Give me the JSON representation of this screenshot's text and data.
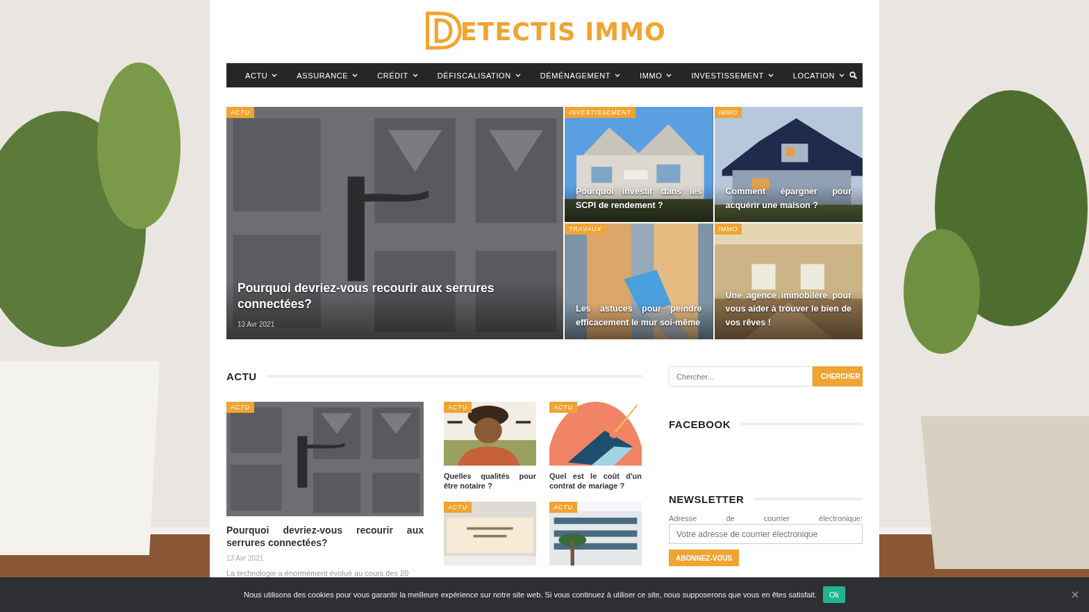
{
  "logo": {
    "initial": "D",
    "rest": "ETECTIS IMMO"
  },
  "nav": [
    {
      "label": "ACTU"
    },
    {
      "label": "ASSURANCE"
    },
    {
      "label": "CRÉDIT"
    },
    {
      "label": "DÉFISCALISATION"
    },
    {
      "label": "DÉMÉNAGEMENT"
    },
    {
      "label": "IMMO"
    },
    {
      "label": "INVESTISSEMENT"
    },
    {
      "label": "LOCATION"
    }
  ],
  "hero": [
    {
      "category": "ACTU",
      "title": "Pourquoi devriez-vous recourir aux serrures connectées?",
      "date": "13 Avr 2021"
    },
    {
      "category": "INVESTISSEMENT",
      "title": "Pourquoi investir dans les SCPI de rendement ?"
    },
    {
      "category": "IMMO",
      "title": "Comment épargner pour acquérir une maison ?"
    },
    {
      "category": "TRAVAUX",
      "title": "Les astuces pour peindre efficacement le mur soi-même"
    },
    {
      "category": "IMMO",
      "title": "Une agence immobilère pour vous aider à trouver le bien de vos rêves !"
    }
  ],
  "section": {
    "title": "ACTU",
    "featured": {
      "category": "ACTU",
      "title": "Pourquoi devriez-vous recourir aux serrures connectées?",
      "date": "13 Avr 2021",
      "excerpt": "La technologie a énormément évolué au cours des 20"
    },
    "posts": [
      {
        "category": "ACTU",
        "title": "Quelles qualités pour être notaire ?"
      },
      {
        "category": "ACTU",
        "title": "Quel est le coût d'un contrat de mariage ?"
      },
      {
        "category": "ACTU"
      },
      {
        "category": "ACTU"
      }
    ]
  },
  "sidebar": {
    "search": {
      "placeholder": "Chercher...",
      "button": "CHERCHER"
    },
    "facebook": {
      "title": "FACEBOOK"
    },
    "newsletter": {
      "title": "NEWSLETTER",
      "label": "Adresse de courrier électronique:",
      "placeholder": "Votre adresse de courrier électronique",
      "button": "ABONNEZ-VOUS"
    }
  },
  "cookie": {
    "message": "Nous utilisons des cookies pour vous garantir la meilleure expérience sur notre site web. Si vous continuez à utiliser ce site, nous supposerons que vous en êtes satisfait.",
    "button": "Ok"
  }
}
